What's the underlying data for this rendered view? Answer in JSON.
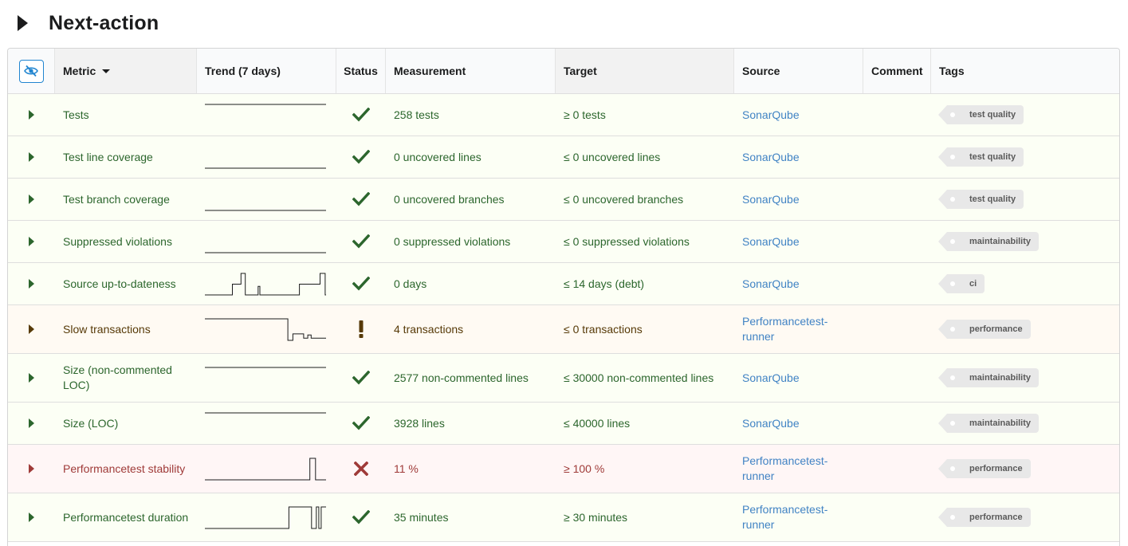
{
  "title": "Next-action",
  "headers": {
    "metric": "Metric",
    "trend": "Trend (7 days)",
    "status": "Status",
    "measurement": "Measurement",
    "target": "Target",
    "source": "Source",
    "comment": "Comment",
    "tags": "Tags"
  },
  "colors": {
    "ok": "#2c662d",
    "warning": "#573a08",
    "bad": "#9f3a38",
    "link": "#4183c4"
  },
  "rows": [
    {
      "metric": "Tests",
      "status": "ok",
      "measurement": "258 tests",
      "target": "≥ 0 tests",
      "source": "SonarQube",
      "comment": "",
      "tag": "test quality",
      "trend": [
        1,
        1,
        1,
        1,
        1,
        1,
        1
      ]
    },
    {
      "metric": "Test line coverage",
      "status": "ok",
      "measurement": "0 uncovered lines",
      "target": "≤ 0 uncovered lines",
      "source": "SonarQube",
      "comment": "",
      "tag": "test quality",
      "trend": [
        0,
        0,
        0,
        0,
        0,
        0,
        0
      ]
    },
    {
      "metric": "Test branch coverage",
      "status": "ok",
      "measurement": "0 uncovered branches",
      "target": "≤ 0 uncovered branches",
      "source": "SonarQube",
      "comment": "",
      "tag": "test quality",
      "trend": [
        0,
        0,
        0,
        0,
        0,
        0,
        0
      ]
    },
    {
      "metric": "Suppressed violations",
      "status": "ok",
      "measurement": "0 suppressed violations",
      "target": "≤ 0 suppressed violations",
      "source": "SonarQube",
      "comment": "",
      "tag": "maintainability",
      "trend": [
        0,
        0,
        0,
        0,
        0,
        0,
        0
      ]
    },
    {
      "metric": "Source up-to-dateness",
      "status": "ok",
      "measurement": "0 days",
      "target": "≤ 14 days (debt)",
      "source": "SonarQube",
      "comment": "",
      "tag": "ci",
      "trend": [
        0,
        0,
        0,
        0,
        0,
        0,
        0,
        0,
        0,
        0,
        0,
        0,
        0,
        0,
        0,
        0,
        0,
        0,
        0,
        0,
        0,
        0,
        0,
        0,
        0,
        0,
        0,
        0,
        0,
        0,
        0,
        0,
        0.5,
        0.5,
        0.5,
        0.5,
        0.5,
        0.5,
        0.5,
        0.5,
        0.5,
        0.5,
        1,
        1,
        1,
        1,
        1,
        0,
        0,
        0,
        0,
        0,
        0,
        0,
        0,
        0,
        0,
        0,
        0,
        0,
        0,
        0,
        0.4,
        0.4,
        0,
        0,
        0,
        0,
        0,
        0,
        0,
        0,
        0,
        0,
        0,
        0,
        0,
        0,
        0,
        0,
        0,
        0,
        0,
        0,
        0,
        0,
        0,
        0,
        0,
        0,
        0,
        0,
        0,
        0,
        0,
        0,
        0,
        0,
        0,
        0,
        0,
        0,
        0,
        0,
        0,
        0,
        0,
        0,
        0,
        0,
        0.5,
        0.5,
        0.5,
        0.5,
        0.5,
        0.5,
        0.5,
        0.5,
        0.5,
        0.5,
        0.5,
        0.5,
        0.5,
        0.5,
        0.5,
        0.5,
        0.5,
        0.5,
        0.5,
        0.5,
        0.5,
        0.5,
        0.5,
        0.5,
        1,
        1,
        1,
        1,
        1,
        1,
        0
      ]
    },
    {
      "metric": "Slow transactions",
      "status": "warning",
      "measurement": "4 transactions",
      "target": "≤ 0 transactions",
      "source": "Performancetest-runner",
      "comment": "",
      "tag": "performance",
      "trend": [
        1,
        1,
        1,
        1,
        1,
        1,
        1,
        1,
        1,
        1,
        1,
        1,
        1,
        1,
        1,
        1,
        1,
        1,
        1,
        1,
        1,
        1,
        1,
        1,
        1,
        1,
        1,
        1,
        1,
        1,
        1,
        1,
        1,
        1,
        1,
        1,
        1,
        1,
        1,
        1,
        1,
        1,
        1,
        1,
        1,
        1,
        1,
        1,
        1,
        1,
        1,
        1,
        1,
        1,
        1,
        1,
        1,
        1,
        1,
        1,
        1,
        1,
        1,
        1,
        1,
        1,
        1,
        1,
        1,
        1,
        1,
        1,
        1,
        1,
        1,
        1,
        1,
        1,
        1,
        1,
        1,
        1,
        1,
        1,
        1,
        1,
        1,
        1,
        1,
        1,
        1,
        1,
        1,
        1,
        1,
        1,
        1,
        1,
        1,
        1,
        0,
        0,
        0,
        0,
        0,
        0,
        0.3,
        0.3,
        0.3,
        0.3,
        0.3,
        0.3,
        0.3,
        0.3,
        0.3,
        0.3,
        0.3,
        0.3,
        0.3,
        0.1,
        0.1,
        0.1,
        0.1,
        0.1,
        0.25,
        0.25,
        0.25,
        0.25,
        0.1,
        0.1,
        0.1,
        0.1,
        0.1,
        0.1,
        0.1,
        0.1,
        0.1,
        0.1,
        0.1,
        0.1,
        0.1,
        0.1,
        0.1,
        0.1,
        0.1,
        0.1
      ]
    },
    {
      "metric": "Size (non-commented LOC)",
      "status": "ok",
      "measurement": "2577 non-commented lines",
      "target": "≤ 30000 non-commented lines",
      "source": "SonarQube",
      "comment": "",
      "tag": "maintainability",
      "trend": [
        1,
        1,
        1,
        1,
        1,
        1,
        1
      ]
    },
    {
      "metric": "Size (LOC)",
      "status": "ok",
      "measurement": "3928 lines",
      "target": "≤ 40000 lines",
      "source": "SonarQube",
      "comment": "",
      "tag": "maintainability",
      "trend": [
        1,
        1,
        1,
        1,
        1,
        1,
        1
      ]
    },
    {
      "metric": "Performancetest stability",
      "status": "bad",
      "measurement": "11 %",
      "target": "≥ 100 %",
      "source": "Performancetest-runner",
      "comment": "",
      "tag": "performance",
      "trend": [
        0,
        0,
        0,
        0,
        0,
        0,
        0,
        0,
        0,
        0,
        0,
        0,
        0,
        0,
        0,
        0,
        0,
        0,
        0,
        0,
        0,
        0,
        0,
        0,
        0,
        0,
        0,
        0,
        0,
        0,
        0,
        0,
        0,
        0,
        0,
        0,
        0,
        0,
        0,
        0,
        0,
        0,
        0,
        0,
        0,
        0,
        0,
        0,
        0,
        0,
        0,
        0,
        0,
        0,
        0,
        0,
        0,
        0,
        0,
        0,
        0,
        0,
        0,
        0,
        0,
        0,
        0,
        0,
        0,
        0,
        0,
        0,
        0,
        0,
        0,
        0,
        0,
        0,
        0,
        0,
        0,
        0,
        0,
        0,
        0,
        0,
        0,
        0,
        0,
        0,
        0,
        0,
        0,
        0,
        0,
        0,
        0,
        0,
        0,
        0,
        0,
        0,
        0,
        0,
        0,
        0,
        0,
        0,
        0,
        0,
        0,
        0,
        0,
        0,
        0,
        0,
        0,
        0,
        0,
        0,
        0,
        0,
        0,
        0,
        0,
        0,
        0,
        0,
        0,
        0,
        1,
        1,
        1,
        1,
        1,
        1,
        1,
        0,
        0,
        0,
        0,
        0,
        0,
        0,
        0,
        0,
        0,
        0,
        0,
        0
      ]
    },
    {
      "metric": "Performancetest duration",
      "status": "ok",
      "measurement": "35 minutes",
      "target": "≥ 30 minutes",
      "source": "Performancetest-runner",
      "comment": "",
      "tag": "performance",
      "trend": [
        0,
        0,
        0,
        0,
        0,
        0,
        0,
        0,
        0,
        0,
        0,
        0,
        0,
        0,
        0,
        0,
        0,
        0,
        0,
        0,
        0,
        0,
        0,
        0,
        0,
        0,
        0,
        0,
        0,
        0,
        0,
        0,
        0,
        0,
        0,
        0,
        0,
        0,
        0,
        0,
        0,
        0,
        0,
        0,
        0,
        0,
        0,
        0,
        0,
        0,
        0,
        0,
        0,
        0,
        0,
        0,
        0,
        0,
        0,
        0,
        0,
        0,
        0,
        0,
        0,
        0,
        0,
        0,
        0,
        0,
        0,
        0,
        0,
        0,
        0,
        0,
        0,
        0,
        0,
        0,
        0,
        0,
        0,
        0,
        0,
        0,
        0,
        0,
        0,
        0,
        0,
        0,
        0,
        0,
        0,
        0,
        0,
        0,
        0,
        0,
        0,
        0,
        0,
        0,
        1,
        1,
        1,
        1,
        1,
        1,
        1,
        1,
        1,
        1,
        1,
        1,
        1,
        1,
        1,
        1,
        1,
        1,
        1,
        1,
        1,
        1,
        1,
        1,
        1,
        1,
        1,
        1,
        0,
        0,
        0,
        0,
        0,
        0,
        1,
        1,
        1,
        0,
        0,
        0,
        1,
        1,
        1,
        1,
        1,
        1
      ]
    }
  ]
}
